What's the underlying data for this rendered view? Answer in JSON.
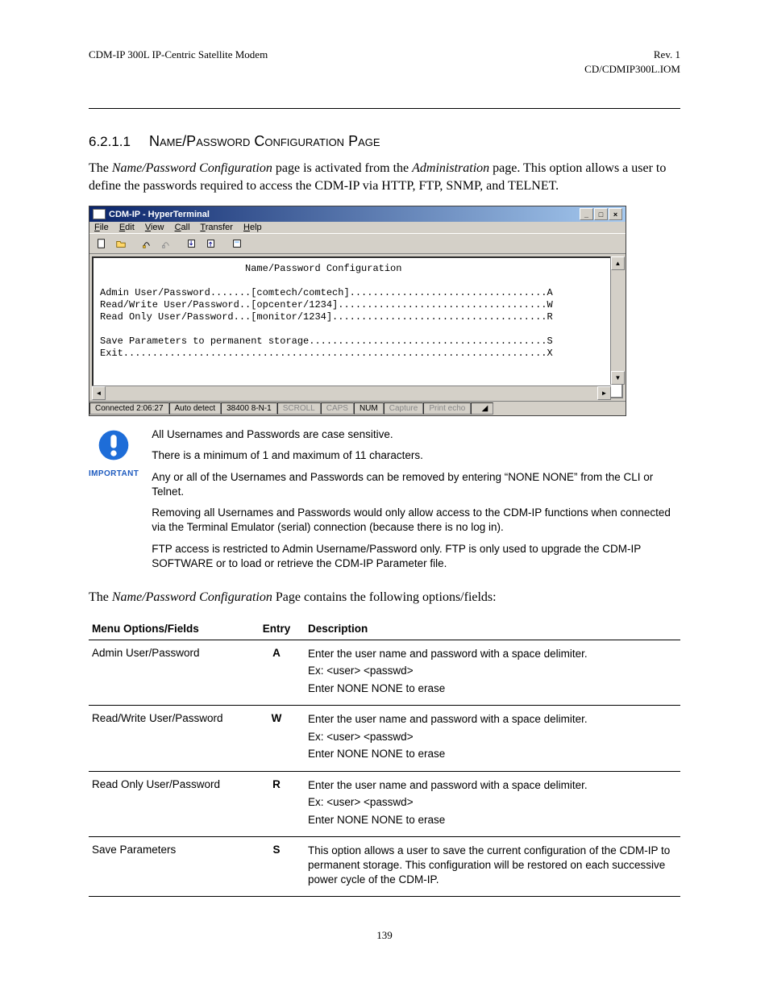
{
  "header": {
    "left": "CDM-IP 300L IP-Centric Satellite Modem",
    "right": "Rev. 1",
    "right2": "CD/CDMIP300L.IOM"
  },
  "section": {
    "number": "6.2.1.1",
    "title": "Name/Password Configuration Page"
  },
  "intro": {
    "p1_a": "The ",
    "p1_b": "Name/Password Configuration",
    "p1_c": " page is activated from the ",
    "p1_d": "Administration",
    "p1_e": " page. This option allows a user to define the passwords required to access the CDM-IP via HTTP, FTP, SNMP, and TELNET."
  },
  "ht": {
    "title": "CDM-IP - HyperTerminal",
    "menus": [
      "File",
      "Edit",
      "View",
      "Call",
      "Transfer",
      "Help"
    ],
    "term_title": "Name/Password Configuration",
    "lines": [
      "Admin User/Password.......[comtech/comtech]..................................A",
      "Read/Write User/Password..[opcenter/1234]....................................W",
      "Read Only User/Password...[monitor/1234].....................................R",
      "",
      "Save Parameters to permanent storage.........................................S",
      "Exit.........................................................................X"
    ],
    "status": {
      "conn": "Connected 2:06:27",
      "detect": "Auto detect",
      "baud": "38400 8-N-1",
      "scroll": "SCROLL",
      "caps": "CAPS",
      "num": "NUM",
      "capture": "Capture",
      "echo": "Print echo"
    }
  },
  "important": {
    "label": "IMPORTANT",
    "p1": "All Usernames and Passwords are case sensitive.",
    "p2": "There is a minimum of 1 and maximum of 11 characters.",
    "p3": "Any or all of the Usernames and Passwords can be removed by entering “NONE NONE” from the CLI or Telnet.",
    "p4": "Removing all Usernames and Passwords would only allow access to the CDM-IP functions when connected via the Terminal Emulator (serial) connection (because there is no log in).",
    "p5": "FTP access is restricted to Admin Username/Password only. FTP is only used to upgrade the CDM-IP SOFTWARE or to load or retrieve the CDM-IP Parameter file."
  },
  "followup": {
    "a": "The ",
    "b": "Name/Password Configuration",
    "c": " Page contains the following options/fields:"
  },
  "table": {
    "headers": {
      "menu": "Menu Options/Fields",
      "entry": "Entry",
      "desc": "Description"
    },
    "rows": [
      {
        "menu": "Admin User/Password",
        "entry": "A",
        "desc": [
          "Enter the user name and password with a space delimiter.",
          "Ex: <user> <passwd>",
          "Enter NONE NONE to erase"
        ]
      },
      {
        "menu": "Read/Write User/Password",
        "entry": "W",
        "desc": [
          "Enter the user name and password with a space delimiter.",
          "Ex: <user> <passwd>",
          "Enter NONE NONE to erase"
        ]
      },
      {
        "menu": "Read Only User/Password",
        "entry": "R",
        "desc": [
          "Enter the user name and password with a space delimiter.",
          "Ex: <user> <passwd>",
          "Enter NONE NONE to erase"
        ]
      },
      {
        "menu": "Save Parameters",
        "entry": "S",
        "desc": [
          "This option allows a user to save the current configuration of the CDM-IP to permanent storage. This configuration will be restored on each successive power cycle of the CDM-IP."
        ]
      }
    ]
  },
  "page_number": "139"
}
